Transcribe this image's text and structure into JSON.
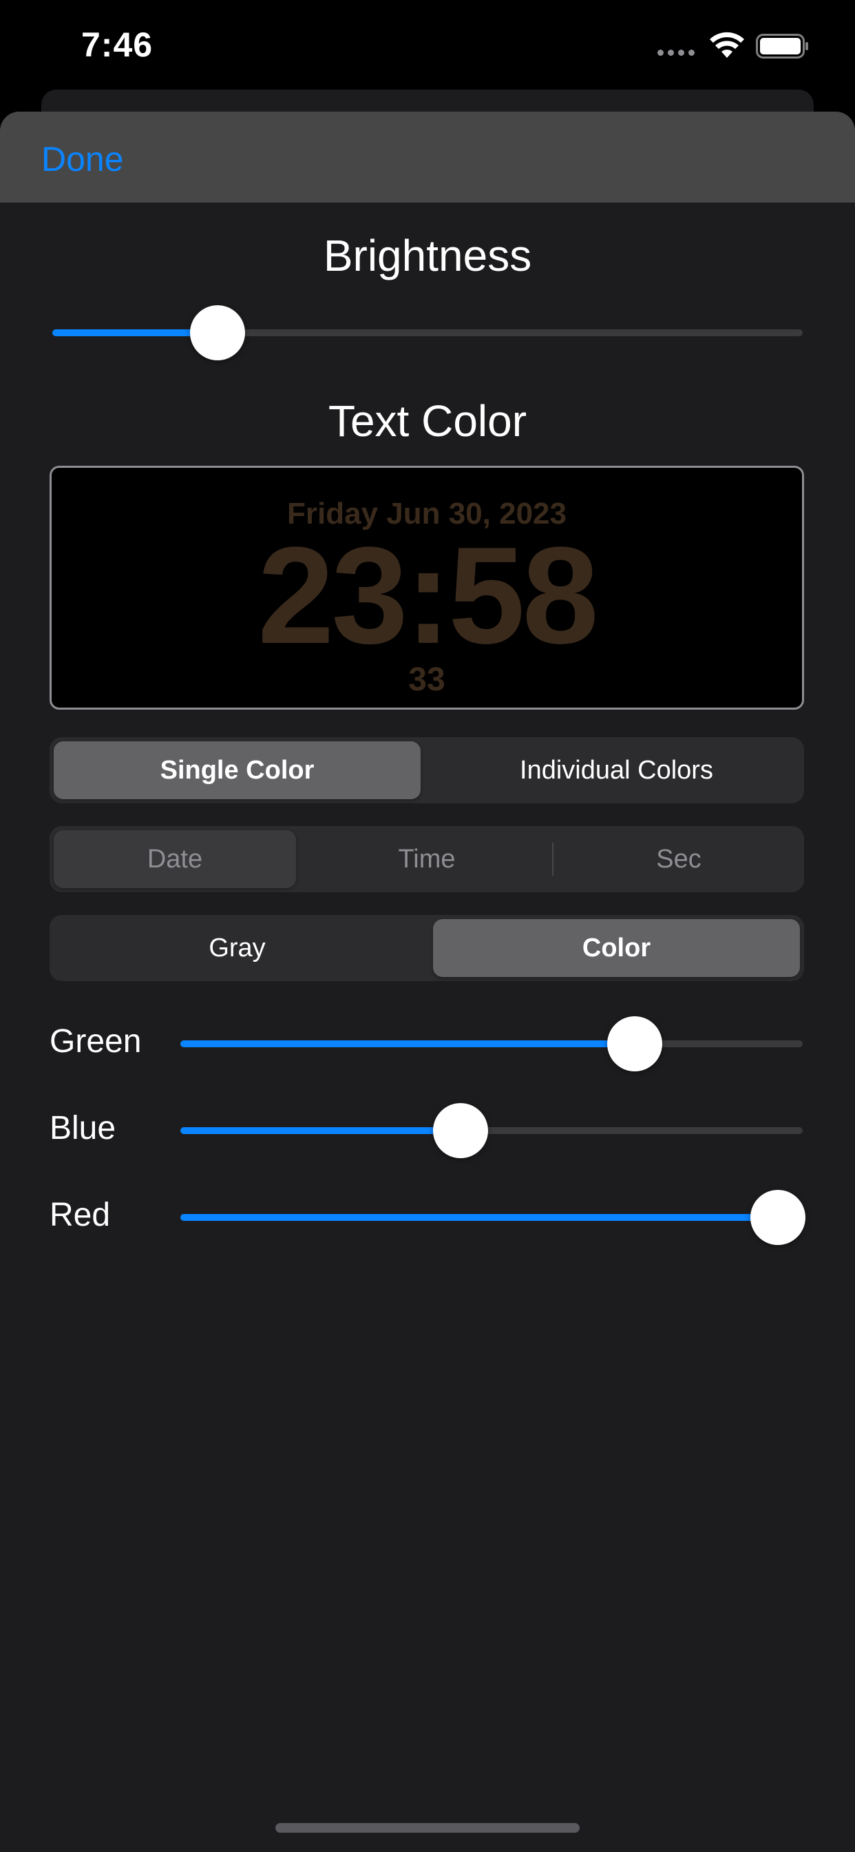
{
  "status_bar": {
    "time": "7:46"
  },
  "header": {
    "done_label": "Done"
  },
  "brightness": {
    "title": "Brightness",
    "value": 0.22
  },
  "text_color": {
    "title": "Text Color",
    "preview": {
      "date": "Friday Jun 30, 2023",
      "time": "23:58",
      "seconds": "33",
      "text_color": "#3a2a1c"
    }
  },
  "mode_control": {
    "options": [
      "Single Color",
      "Individual Colors"
    ],
    "selected": "Single Color"
  },
  "part_control": {
    "options": [
      "Date",
      "Time",
      "Sec"
    ],
    "selected": "Date",
    "enabled": false
  },
  "color_type_control": {
    "options": [
      "Gray",
      "Color"
    ],
    "selected": "Color"
  },
  "color_sliders": [
    {
      "label": "Green",
      "value": 0.73
    },
    {
      "label": "Blue",
      "value": 0.45
    },
    {
      "label": "Red",
      "value": 0.96
    }
  ],
  "colors": {
    "accent": "#0a84ff",
    "sheet_background": "#1c1c1e",
    "header_background": "#474747",
    "segment_background": "#2c2c2e",
    "segment_selected": "#636366"
  },
  "icons": {
    "wifi": "wifi-icon",
    "battery": "battery-icon",
    "signal": "signal-icon"
  }
}
